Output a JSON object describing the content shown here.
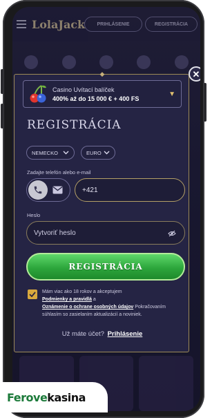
{
  "header": {
    "logo": "LolaJack",
    "login_label": "PRIHLÁSENIE",
    "register_label": "REGISTRÁCIA"
  },
  "bonus": {
    "title": "Casino Uvítací balíček",
    "subtitle": "400% až do 15 000 € + 400 FS"
  },
  "form": {
    "title": "REGISTRÁCIA",
    "country": "NEMECKO",
    "currency": "EURO",
    "contact_label": "Zadajte telefón alebo e-mail",
    "phone_value": "+421",
    "password_label": "Heslo",
    "password_placeholder": "Vytvoriť heslo",
    "submit_label": "REGISTRÁCIA",
    "terms_part1": "Mám viac ako 18 rokov a akceptujem",
    "terms_link1": "Podmienky a pravidlá",
    "terms_part2": " a",
    "terms_link2": "Oznámenie o ochrane osobných údajov",
    "terms_part3": " Pokračovaním súhlasím so zasielaním aktualizácií a noviniek.",
    "have_account": "Už máte účet?",
    "login_link": "Prihlásenie"
  },
  "watermark": {
    "part1": "Ferove",
    "part2": "kasina"
  },
  "colors": {
    "accent_gold": "#b5a067",
    "cta_green": "#2da63c",
    "modal_bg": "#252444"
  },
  "icons": [
    "menu-icon",
    "cherry-icon",
    "chevron-down-icon",
    "phone-icon",
    "mail-icon",
    "eye-off-icon",
    "check-icon",
    "close-icon"
  ]
}
